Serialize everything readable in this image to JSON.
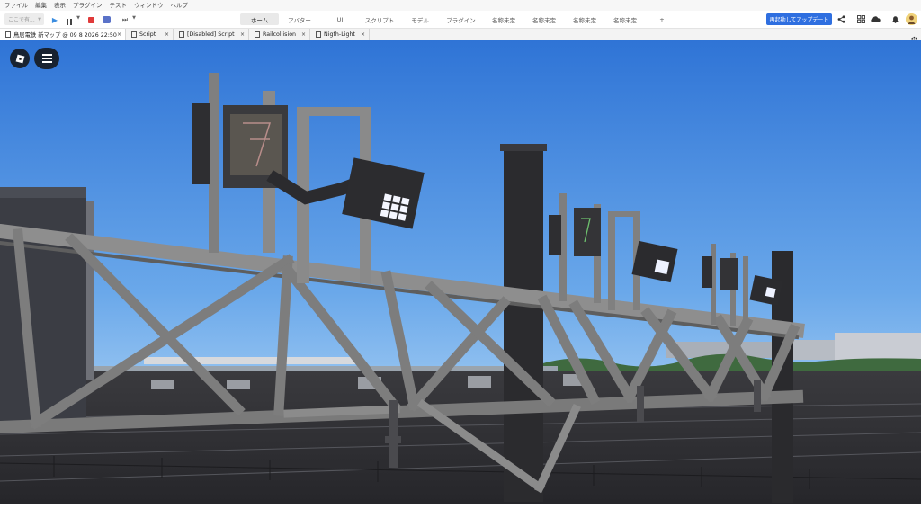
{
  "menu": {
    "items": [
      "ファイル",
      "編集",
      "表示",
      "プラグイン",
      "テスト",
      "ウィンドウ",
      "ヘルプ"
    ]
  },
  "toolbar": {
    "mode_placeholder": "ここで有..."
  },
  "ribbon": {
    "tabs": [
      "ホーム",
      "アバター",
      "UI",
      "スクリプト",
      "モデル",
      "プラグイン",
      "名称未定",
      "名称未定",
      "名称未定",
      "名称未定"
    ],
    "active": "ホーム",
    "add_tab_label": "+",
    "update_button": "再起動してアップデート"
  },
  "doc_tabs": [
    {
      "label": "鳥居電鉄 新マップ @ 09 8 2026 22:50",
      "icon": "place-icon",
      "active": true
    },
    {
      "label": "Script",
      "icon": "script-icon",
      "active": false
    },
    {
      "label": "[Disabled] Script",
      "icon": "script-icon",
      "active": false
    },
    {
      "label": "Railcollision",
      "icon": "script-icon",
      "active": false
    },
    {
      "label": "Nigth-Light",
      "icon": "script-icon",
      "active": false
    }
  ],
  "colors": {
    "accent": "#2f6fe0",
    "stop": "#e03a3a",
    "play": "#3b8de0",
    "sky_top": "#2f74d6",
    "sky_bottom": "#8cbef0"
  },
  "viewport": {
    "overlay_buttons": [
      "roblox-logo-icon",
      "hamburger-menu-icon"
    ]
  }
}
